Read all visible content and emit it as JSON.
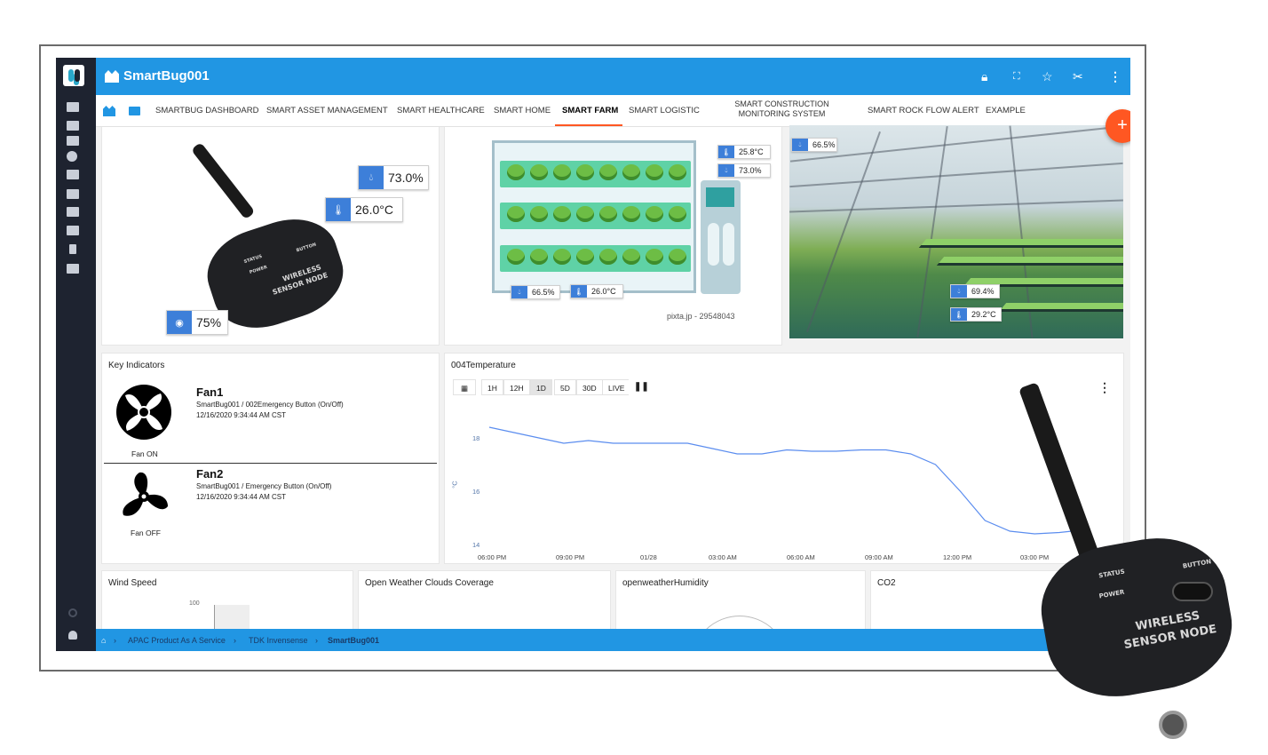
{
  "app": {
    "title": "SmartBug001",
    "nav_items": [
      "SMARTBUG DASHBOARD",
      "SMART ASSET MANAGEMENT",
      "SMART HEALTHCARE",
      "SMART HOME",
      "SMART FARM",
      "SMART LOGISTIC",
      "SMART CONSTRUCTION",
      "MONITORING SYSTEM",
      "SMART ROCK FLOW ALERT",
      "EXAMPLE"
    ],
    "active_nav": "SMART FARM",
    "fab_label": "+"
  },
  "topbar_icons": [
    "lock-icon",
    "fullscreen-icon",
    "star-icon",
    "tools-icon",
    "more-vert-icon"
  ],
  "sensor_panel": {
    "humidity": "73.0%",
    "temperature": "26.0°C",
    "battery": "75%",
    "device_labels": [
      "STATUS",
      "BUTTON",
      "POWER",
      "WIRELESS",
      "SENSOR NODE"
    ]
  },
  "farm_panel": {
    "temp_top": "25.8°C",
    "hum_top": "73.0%",
    "hum_bottom": "66.5%",
    "temp_bottom": "26.0°C",
    "credit": "pixta.jp - 29548043"
  },
  "greenhouse_panel": {
    "hum_top": "66.5%",
    "hum_bottom": "69.4%",
    "temp_bottom": "29.2°C"
  },
  "key_indicators": {
    "title": "Key Indicators",
    "fans": [
      {
        "name": "Fan1",
        "source": "SmartBug001 / 002Emergency Button (On/Off)",
        "timestamp": "12/16/2020 9:34:44 AM CST",
        "state": "Fan ON"
      },
      {
        "name": "Fan2",
        "source": "SmartBug001 / Emergency Button (On/Off)",
        "timestamp": "12/16/2020 9:34:44 AM CST",
        "state": "Fan OFF"
      }
    ]
  },
  "temperature_chart": {
    "title": "004Temperature",
    "ranges": [
      "1H",
      "12H",
      "1D",
      "5D",
      "30D",
      "LIVE"
    ],
    "active_range": "1D",
    "pause": "❚❚"
  },
  "chart_data": {
    "type": "line",
    "title": "004Temperature",
    "xlabel": "",
    "ylabel": "°C",
    "ylim": [
      14,
      18.6
    ],
    "yticks": [
      "18",
      "16",
      "14"
    ],
    "x": [
      "06:00 PM",
      "09:00 PM",
      "01/28",
      "03:00 AM",
      "06:00 AM",
      "09:00 AM",
      "12:00 PM",
      "03:00 PM"
    ],
    "series": [
      {
        "values": [
          18.4,
          18.2,
          18.0,
          17.8,
          17.9,
          17.8,
          17.8,
          17.8,
          17.8,
          17.6,
          17.4,
          17.4,
          17.55,
          17.5,
          17.5,
          17.55,
          17.55,
          17.4,
          17.0,
          16.0,
          14.9,
          14.5,
          14.4,
          14.45,
          14.55
        ]
      }
    ],
    "color": "#5b8def"
  },
  "bottom_panels": {
    "wind": "Wind Speed",
    "wind_tick": "100",
    "clouds": "Open Weather Clouds Coverage",
    "humidity": "openweatherHumidity",
    "co2": "CO2"
  },
  "breadcrumb": {
    "items": [
      "APAC Product As A Service",
      "TDK Invensense",
      "SmartBug001"
    ]
  },
  "overlay_device": {
    "labels": [
      "STATUS",
      "BUTTON",
      "POWER",
      "WIRELESS",
      "SENSOR NODE"
    ]
  }
}
